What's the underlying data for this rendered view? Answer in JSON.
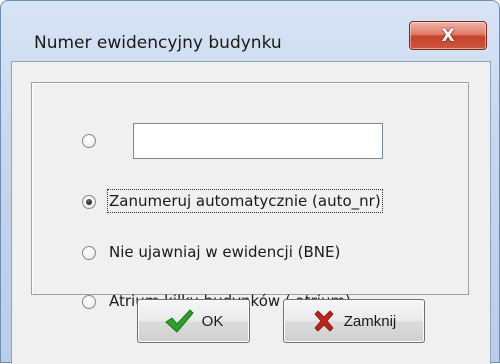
{
  "window": {
    "title": "Numer ewidencyjny budynku",
    "close_glyph": "X"
  },
  "options": {
    "custom": {
      "value": "",
      "selected": false
    },
    "auto": {
      "label": "Zanumeruj automatycznie (auto_nr)",
      "selected": true
    },
    "bne": {
      "label": "Nie ujawniaj w ewidencji (BNE)",
      "selected": false
    },
    "atrium": {
      "label": "Atrium kilku budynków (.atrium)",
      "selected": false
    }
  },
  "buttons": {
    "ok_label": "OK",
    "close_label": "Zamknij"
  },
  "icons": {
    "ok": "checkmark-icon",
    "close": "red-x-icon"
  },
  "colors": {
    "ok_icon": "#2aa12a",
    "close_icon": "#c0221a",
    "title_close_button": "#d0573f"
  }
}
